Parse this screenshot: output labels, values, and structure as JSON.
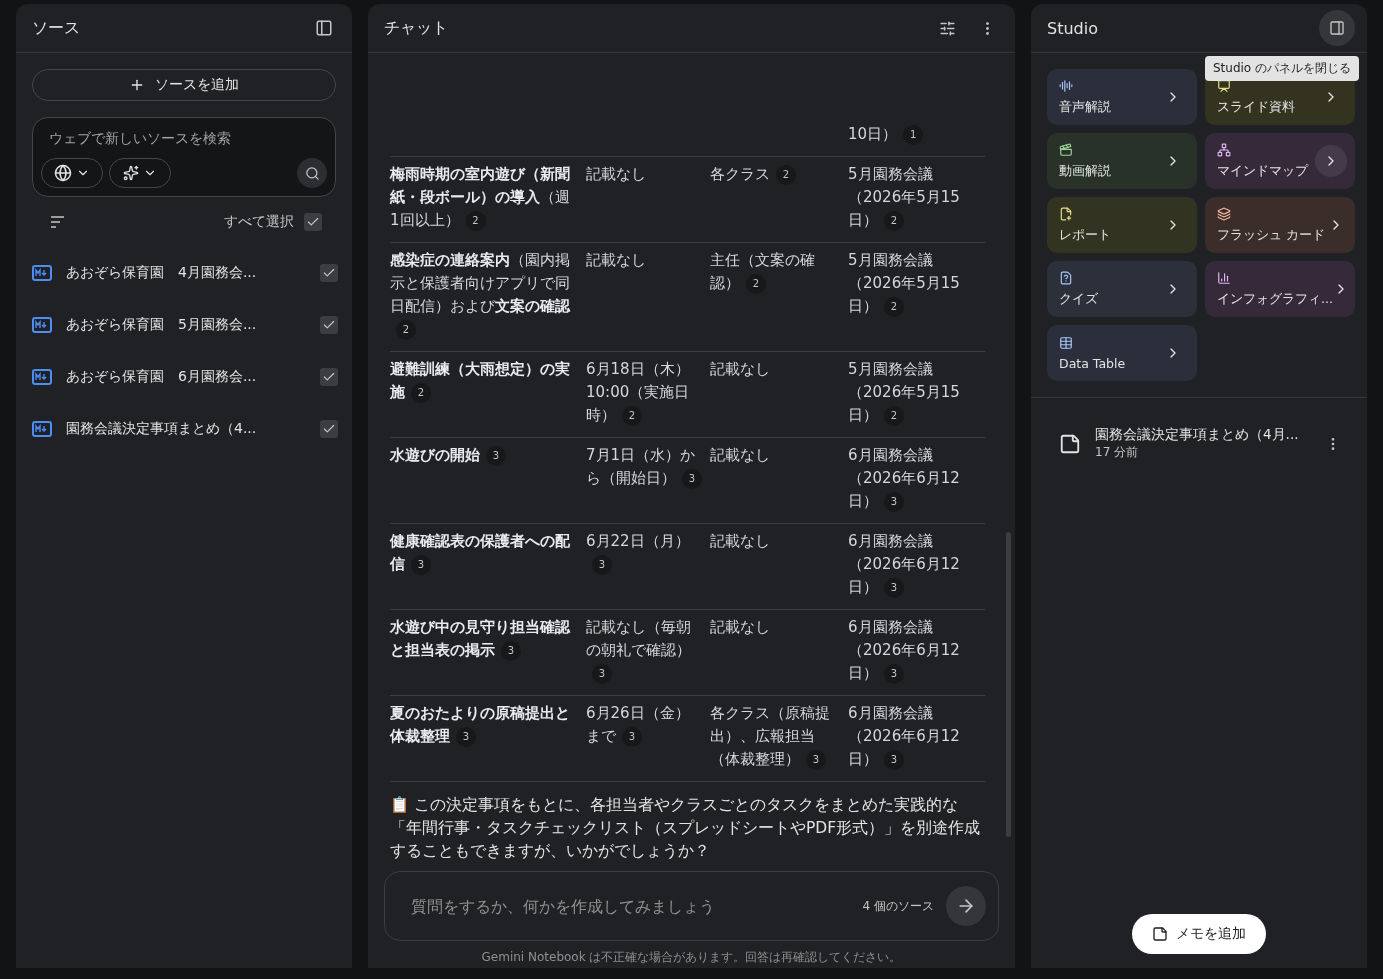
{
  "sources": {
    "title": "ソース",
    "add_button": "ソースを追加",
    "search": {
      "placeholder": "ウェブで新しいソースを検索"
    },
    "select_all": {
      "label": "すべて選択",
      "checked": true
    },
    "items": [
      {
        "title": "あおぞら保育園　4月園務会...",
        "checked": true
      },
      {
        "title": "あおぞら保育園　5月園務会...",
        "checked": true
      },
      {
        "title": "あおぞら保育園　6月園務会...",
        "checked": true
      },
      {
        "title": "園務会議決定事項まとめ（4...",
        "checked": true
      }
    ]
  },
  "chat": {
    "title": "チャット",
    "rows": [
      {
        "cells": [
          {},
          {},
          {},
          {
            "text": "10日）",
            "cite": "1"
          }
        ]
      },
      {
        "cells": [
          {
            "text": "**梅雨時期の室内遊び（新聞紙・段ボール）の導入**（週1回以上）",
            "cite": "2"
          },
          {
            "text": "記載なし"
          },
          {
            "text": "各クラス",
            "cite": "2"
          },
          {
            "text": "5月園務会議（2026年5月15日）",
            "cite": "2"
          }
        ]
      },
      {
        "cells": [
          {
            "text": "**感染症の連絡案内**（園内掲示と保護者向けアプリで同日配信）および**文案の確認**",
            "cite": "2"
          },
          {
            "text": "記載なし"
          },
          {
            "text": "主任（文案の確認）",
            "cite": "2"
          },
          {
            "text": "5月園務会議（2026年5月15日）",
            "cite": "2"
          }
        ]
      },
      {
        "cells": [
          {
            "text": "**避難訓練（大雨想定）の実施**",
            "cite": "2"
          },
          {
            "text": "6月18日（木）10:00（実施日時）",
            "cite": "2"
          },
          {
            "text": "記載なし"
          },
          {
            "text": "5月園務会議（2026年5月15日）",
            "cite": "2"
          }
        ]
      },
      {
        "cells": [
          {
            "text": "**水遊びの開始**",
            "cite": "3"
          },
          {
            "text": "7月1日（水）から（開始日）",
            "cite": "3"
          },
          {
            "text": "記載なし"
          },
          {
            "text": "6月園務会議（2026年6月12日）",
            "cite": "3"
          }
        ]
      },
      {
        "cells": [
          {
            "text": "**健康確認表の保護者への配信**",
            "cite": "3"
          },
          {
            "text": "6月22日（月）",
            "cite": "3"
          },
          {
            "text": "記載なし"
          },
          {
            "text": "6月園務会議（2026年6月12日）",
            "cite": "3"
          }
        ]
      },
      {
        "cells": [
          {
            "text": "**水遊び中の見守り担当確認と担当表の掲示**",
            "cite": "3"
          },
          {
            "text": "記載なし（毎朝の朝礼で確認）",
            "cite": "3"
          },
          {
            "text": "記載なし"
          },
          {
            "text": "6月園務会議（2026年6月12日）",
            "cite": "3"
          }
        ]
      },
      {
        "cells": [
          {
            "text": "**夏のおたよりの原稿提出と体裁整理**",
            "cite": "3"
          },
          {
            "text": "6月26日（金）まで",
            "cite": "3"
          },
          {
            "text": "各クラス（原稿提出）、広報担当（体裁整理）",
            "cite": "3"
          },
          {
            "text": "6月園務会議（2026年6月12日）",
            "cite": "3"
          }
        ]
      }
    ],
    "message_icon": "📋",
    "message": "この決定事項をもとに、各担当者やクラスごとのタスクをまとめた実践的な「年間行事・タスクチェックリスト（スプレッドシートやPDF形式）」を別途作成することもできますが、いかがでしょうか？",
    "input": {
      "placeholder": "質問をするか、何かを作成してみましょう"
    },
    "source_count": "4 個のソース",
    "disclaimer": "Gemini Notebook は不正確な場合があります。回答は再確認してください。"
  },
  "studio": {
    "title": "Studio",
    "tooltip": "Studio のパネルを閉じる",
    "cards": [
      {
        "kind": "audio",
        "label": "音声解説",
        "color": "#2b2e3b",
        "highlighted": false
      },
      {
        "kind": "slides",
        "label": "スライド資料",
        "color": "#33331f",
        "highlighted": false
      },
      {
        "kind": "video",
        "label": "動画解説",
        "color": "#283228",
        "highlighted": false
      },
      {
        "kind": "mindmap",
        "label": "マインドマップ",
        "color": "#362a3a",
        "highlighted": true
      },
      {
        "kind": "report",
        "label": "レポート",
        "color": "#333321",
        "highlighted": false
      },
      {
        "kind": "flashcards",
        "label": "フラッシュ カード",
        "color": "#3a2d2a",
        "highlighted": false
      },
      {
        "kind": "quiz",
        "label": "クイズ",
        "color": "#2b303b",
        "highlighted": false
      },
      {
        "kind": "infographic",
        "label": "インフォグラフィ...",
        "color": "#362a3a",
        "highlighted": false
      },
      {
        "kind": "table",
        "label": "Data Table",
        "color": "#2b2e3b",
        "highlighted": false
      }
    ],
    "notes": [
      {
        "title": "園務会議決定事項まとめ（4月...",
        "time": "17 分前"
      }
    ],
    "add_note": "メモを追加"
  }
}
